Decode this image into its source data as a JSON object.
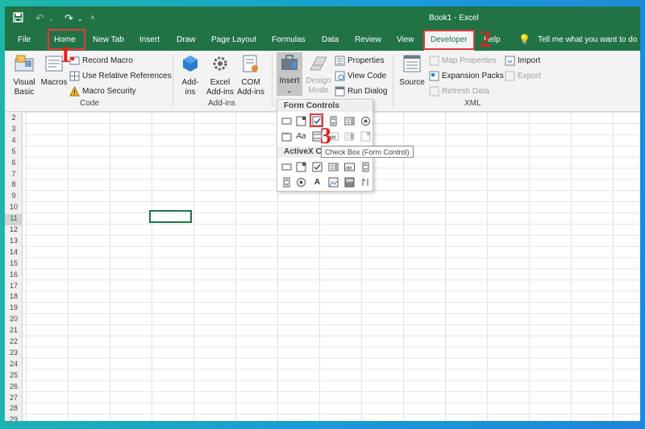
{
  "titlebar": {
    "title": "Book1  -  Excel"
  },
  "tabs": [
    "File",
    "Home",
    "New Tab",
    "Insert",
    "Draw",
    "Page Layout",
    "Formulas",
    "Data",
    "Review",
    "View",
    "Developer",
    "Help"
  ],
  "tell_me": "Tell me what you want to do",
  "ribbon": {
    "code": {
      "visual_basic": "Visual Basic",
      "macros": "Macros",
      "record_macro": "Record Macro",
      "use_relative": "Use Relative References",
      "macro_security": "Macro Security",
      "label": "Code"
    },
    "addins": {
      "addins": "Add-ins",
      "excel_addins": "Excel Add-ins",
      "com_addins": "COM Add-ins",
      "label": "Add-ins"
    },
    "controls": {
      "insert": "Insert",
      "design_mode": "Design Mode",
      "properties": "Properties",
      "view_code": "View Code",
      "run_dialog": "Run Dialog"
    },
    "xml": {
      "source": "Source",
      "map_properties": "Map Properties",
      "expansion_packs": "Expansion Packs",
      "refresh_data": "Refresh Data",
      "import": "Import",
      "export": "Export",
      "label": "XML"
    }
  },
  "dropdown": {
    "form_controls": "Form Controls",
    "activex_controls": "ActiveX Controls",
    "tooltip": "Check Box (Form Control)"
  },
  "rows": [
    "2",
    "3",
    "4",
    "5",
    "6",
    "7",
    "8",
    "9",
    "10",
    "11",
    "12",
    "13",
    "14",
    "15",
    "16",
    "17",
    "18",
    "19",
    "20",
    "21",
    "22",
    "23",
    "24",
    "25",
    "26",
    "27",
    "28",
    "29"
  ],
  "active_row": "11",
  "markers": {
    "m1": "1",
    "m2": "2",
    "m3": "3"
  },
  "colors": {
    "excel_green": "#217346",
    "highlight_red": "#e23b3b"
  }
}
